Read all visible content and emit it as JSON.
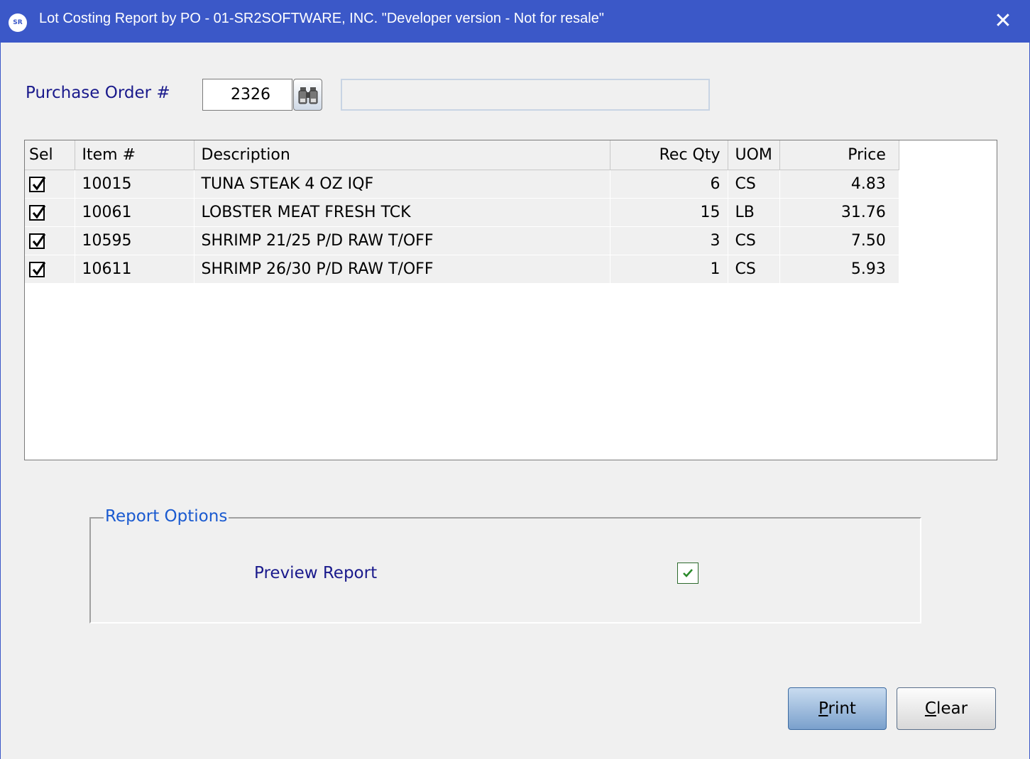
{
  "window": {
    "title": "Lot Costing Report by PO  -  01-SR2SOFTWARE, INC. \"Developer version - Not for resale\"",
    "close_glyph": "✕",
    "icon_text": "SR"
  },
  "po": {
    "label": "Purchase Order #",
    "value": "2326",
    "description": ""
  },
  "grid": {
    "columns": [
      "Sel",
      "Item #",
      "Description",
      "Rec Qty",
      "UOM",
      "Price"
    ],
    "rows": [
      {
        "sel": true,
        "item": "10015",
        "description": "TUNA STEAK 4 OZ IQF",
        "rec_qty": "6",
        "uom": "CS",
        "price": "4.83"
      },
      {
        "sel": true,
        "item": "10061",
        "description": "LOBSTER MEAT FRESH TCK",
        "rec_qty": "15",
        "uom": "LB",
        "price": "31.76"
      },
      {
        "sel": true,
        "item": "10595",
        "description": "SHRIMP 21/25 P/D RAW T/OFF",
        "rec_qty": "3",
        "uom": "CS",
        "price": "7.50"
      },
      {
        "sel": true,
        "item": "10611",
        "description": "SHRIMP 26/30 P/D RAW T/OFF",
        "rec_qty": "1",
        "uom": "CS",
        "price": "5.93"
      }
    ]
  },
  "report_options": {
    "legend": "Report Options",
    "preview_label": "Preview Report",
    "preview_checked": true
  },
  "buttons": {
    "print_first": "P",
    "print_rest": "rint",
    "clear_first": "C",
    "clear_rest": "lear"
  },
  "colors": {
    "titlebar": "#3b58c8",
    "label_text": "#1a1a8c",
    "legend_text": "#1a5ad0",
    "check_green": "#2a8a2a"
  }
}
